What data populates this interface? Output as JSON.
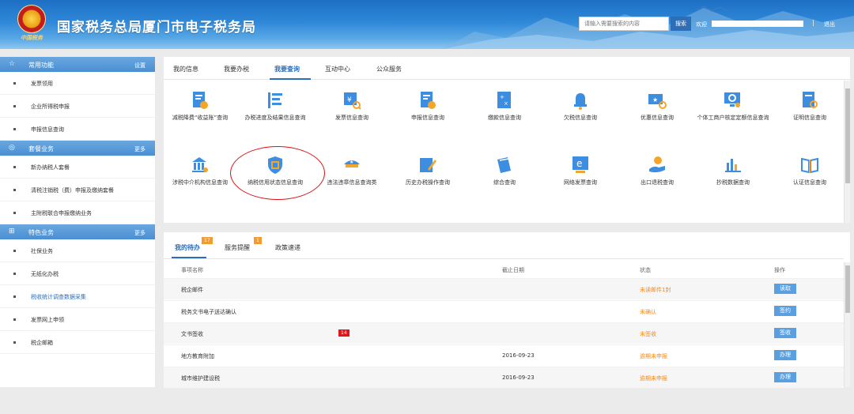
{
  "colors": {
    "brand": "#2c6fb8",
    "accent_orange": "#f28a1e",
    "badge_red": "#e0161a",
    "sidebar_head": "#4a8fd2"
  },
  "header": {
    "title": "国家税务总局厦门市电子税务局",
    "emblem_text": "中国税务",
    "search_placeholder": "请输入需要搜索的内容",
    "search_button": "搜索",
    "welcome": "欢迎",
    "separator": "|",
    "logout": "退出"
  },
  "sidebar": {
    "sections": [
      {
        "title": "常用功能",
        "more": "设置",
        "icon": "star-icon",
        "items": [
          "发票领用",
          "企业所得税申报",
          "申报信息查询"
        ]
      },
      {
        "title": "套餐业务",
        "more": "更多",
        "icon": "package-icon",
        "items": [
          "新办纳税人套餐",
          "清税注销税（费）申报及缴纳套餐",
          "主附税联合申报缴纳业务"
        ]
      },
      {
        "title": "特色业务",
        "more": "更多",
        "icon": "grid-icon",
        "items": [
          "社保业务",
          "无纸化办税",
          "税收统计调查数据采集",
          "发票网上申领",
          "税企邮箱"
        ]
      }
    ]
  },
  "query_panel": {
    "tabs": [
      "我的信息",
      "我要办税",
      "我要查询",
      "互动中心",
      "公众服务"
    ],
    "active_tab": "我要查询",
    "items_row1": [
      "减税降费“收益账”查询",
      "办税进度及结果信息查询",
      "发票信息查询",
      "申报信息查询",
      "缴款信息查询",
      "欠税信息查询",
      "优惠信息查询",
      "个体工商户核定定额信息查询",
      "证明信息查询"
    ],
    "items_row2": [
      "涉税中介机构信息查询",
      "纳税信用状态信息查询",
      "违法违章信息查询类",
      "历史办税操作查询",
      "综合查询",
      "网络发票查询",
      "出口退税查询",
      "抄税数据查询",
      "认证信息查询"
    ]
  },
  "todo_panel": {
    "tabs": [
      {
        "label": "我的待办",
        "badge": "17"
      },
      {
        "label": "服务提醒",
        "badge": "1"
      },
      {
        "label": "政策速递",
        "badge": ""
      }
    ],
    "headers": {
      "name": "事项名称",
      "date": "截止日期",
      "status": "状态",
      "op": "操作"
    },
    "rows": [
      {
        "name": "税企邮件",
        "date": "",
        "status": "未读邮件1封",
        "op": "读取",
        "badge": ""
      },
      {
        "name": "税务文书电子送达确认",
        "date": "",
        "status": "未确认",
        "op": "签约",
        "badge": ""
      },
      {
        "name": "文书签收",
        "date": "",
        "status": "未签收",
        "op": "签收",
        "badge": "14"
      },
      {
        "name": "地方教育附加",
        "date": "2016-09-23",
        "status": "逾期未申报",
        "op": "办理",
        "badge": ""
      },
      {
        "name": "城市维护建设税",
        "date": "2016-09-23",
        "status": "逾期未申报",
        "op": "办理",
        "badge": ""
      }
    ]
  }
}
